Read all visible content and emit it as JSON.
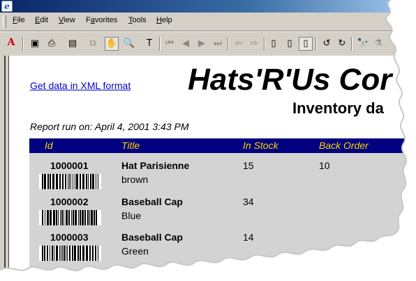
{
  "titlebar": {
    "icon": "ie-logo-icon"
  },
  "menubar": {
    "items": [
      {
        "label": "File",
        "underline": "F",
        "rest": "ile"
      },
      {
        "label": "Edit",
        "underline": "E",
        "rest": "dit"
      },
      {
        "label": "View",
        "underline": "V",
        "rest": "iew"
      },
      {
        "label": "Favorites",
        "underline": "a",
        "prefix": "F",
        "rest": "vorites"
      },
      {
        "label": "Tools",
        "underline": "T",
        "rest": "ools"
      },
      {
        "label": "Help",
        "underline": "H",
        "rest": "elp"
      }
    ]
  },
  "toolbar": {
    "buttons": [
      {
        "name": "acrobat-logo-icon",
        "glyph": "A"
      },
      {
        "name": "save-icon",
        "glyph": "▣"
      },
      {
        "name": "print-icon",
        "glyph": "⎙"
      },
      {
        "name": "show-navigation-pane-icon",
        "glyph": "▤"
      },
      {
        "name": "copy-icon",
        "glyph": "⧉"
      },
      {
        "name": "hand-tool-icon",
        "glyph": "✋"
      },
      {
        "name": "zoom-tool-icon",
        "glyph": "🔍"
      },
      {
        "name": "text-select-icon",
        "glyph": "T"
      },
      {
        "name": "first-page-icon",
        "glyph": "⏮"
      },
      {
        "name": "previous-page-icon",
        "glyph": "◀"
      },
      {
        "name": "next-page-icon",
        "glyph": "▶"
      },
      {
        "name": "last-page-icon",
        "glyph": "⏭"
      },
      {
        "name": "go-back-icon",
        "glyph": "⇦"
      },
      {
        "name": "go-forward-icon",
        "glyph": "⇨"
      },
      {
        "name": "actual-size-icon",
        "glyph": "▯"
      },
      {
        "name": "fit-page-icon",
        "glyph": "▯"
      },
      {
        "name": "fit-width-icon",
        "glyph": "▯"
      },
      {
        "name": "rotate-left-icon",
        "glyph": "↺"
      },
      {
        "name": "rotate-right-icon",
        "glyph": "↻"
      },
      {
        "name": "find-icon",
        "glyph": "🔭"
      },
      {
        "name": "search-icon",
        "glyph": "⚗"
      }
    ]
  },
  "document": {
    "xml_link": "Get data in XML format",
    "company": "Hats'R'Us Cor",
    "subtitle": "Inventory da",
    "report_run": "Report run on:   April 4, 2001 3:43 PM",
    "columns": [
      "Id",
      "Title",
      "In Stock",
      "Back Order"
    ],
    "rows": [
      {
        "id": "1000001",
        "title": "Hat Parisienne",
        "color": "brown",
        "in_stock": "15",
        "back_order": "10"
      },
      {
        "id": "1000002",
        "title": "Baseball Cap",
        "color": "Blue",
        "in_stock": "34",
        "back_order": ""
      },
      {
        "id": "1000003",
        "title": "Baseball Cap",
        "color": "Green",
        "in_stock": "14",
        "back_order": ""
      }
    ],
    "header_bg": "#000080",
    "header_text_color": "#ffd700",
    "row_bg": "#d3d3d3"
  }
}
